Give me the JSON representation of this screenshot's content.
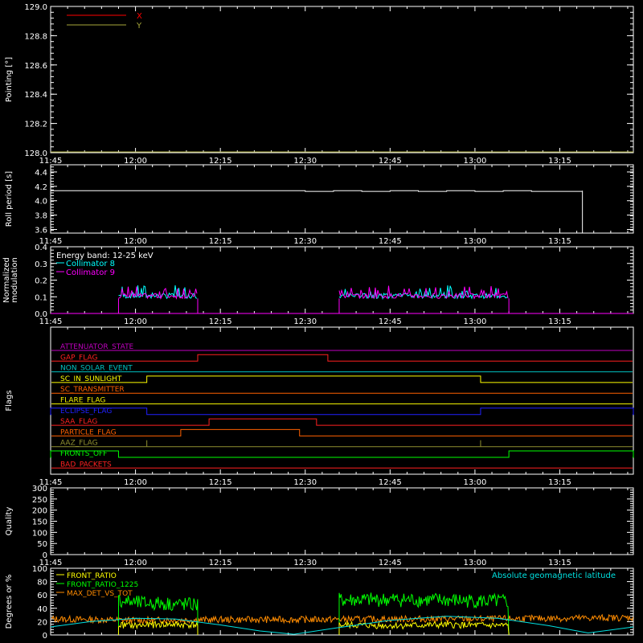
{
  "chart_data": [
    {
      "type": "line",
      "panel": "pointing",
      "ylabel": "Pointing [°]",
      "ylim": [
        128.0,
        129.0
      ],
      "yticks": [
        "128.0",
        "128.2",
        "128.4",
        "128.6",
        "128.8",
        "129.0"
      ],
      "xlim": [
        "11:45",
        "13:28"
      ],
      "xticks": [
        "11:45",
        "12:00",
        "12:15",
        "12:30",
        "12:45",
        "13:00",
        "13:15"
      ],
      "legend": "top-left",
      "series": [
        {
          "name": "X",
          "color": "#ff0000",
          "x": [
            "11:45",
            "13:28"
          ],
          "values": [
            128.0,
            128.0
          ]
        },
        {
          "name": "Y",
          "color": "#a8a83a",
          "x": [
            "11:45",
            "13:28"
          ],
          "values": [
            128.0,
            128.0
          ]
        }
      ]
    },
    {
      "type": "line",
      "panel": "roll",
      "ylabel": "Roll period [s]",
      "ylim": [
        3.55,
        4.5
      ],
      "yticks": [
        "3.6",
        "3.8",
        "4.0",
        "4.2",
        "4.4"
      ],
      "xticks": [
        "11:45",
        "12:00",
        "12:15",
        "12:30",
        "12:45",
        "13:00",
        "13:15"
      ],
      "series": [
        {
          "name": "",
          "color": "#ffffff",
          "x": [
            "11:45",
            "12:30",
            "12:30",
            "12:35",
            "12:40",
            "12:45",
            "12:50",
            "12:55",
            "13:00",
            "13:05",
            "13:10",
            "13:19",
            "13:19"
          ],
          "values": [
            4.14,
            4.14,
            4.13,
            4.14,
            4.13,
            4.14,
            4.13,
            4.14,
            4.13,
            4.14,
            4.13,
            4.14,
            3.55
          ]
        }
      ]
    },
    {
      "type": "line",
      "panel": "modulation",
      "ylabel": "Normalized modulation",
      "ylim": [
        0.0,
        0.4
      ],
      "yticks": [
        "0.0",
        "0.1",
        "0.2",
        "0.3",
        "0.4"
      ],
      "xticks": [
        "11:45",
        "12:00",
        "12:15",
        "12:30",
        "12:45",
        "13:00",
        "13:15"
      ],
      "annotation": "Energy band: 12-25 keV",
      "series": [
        {
          "name": "Collimator 8",
          "color": "#00ffff",
          "x": [
            "11:57",
            "12:00",
            "12:03",
            "12:06",
            "12:09",
            "12:11",
            "12:36",
            "12:40",
            "12:45",
            "12:50",
            "12:55",
            "13:00",
            "13:05"
          ],
          "values": [
            0.09,
            0.13,
            0.11,
            0.14,
            0.12,
            0.1,
            0.09,
            0.14,
            0.17,
            0.15,
            0.12,
            0.11,
            0.1
          ]
        },
        {
          "name": "Collimator 9",
          "color": "#ff00ff",
          "x": [
            "11:57",
            "12:00",
            "12:03",
            "12:06",
            "12:09",
            "12:11",
            "12:36",
            "12:40",
            "12:45",
            "12:50",
            "12:55",
            "13:00",
            "13:05"
          ],
          "values": [
            0.08,
            0.14,
            0.12,
            0.15,
            0.11,
            0.1,
            0.1,
            0.16,
            0.2,
            0.14,
            0.13,
            0.12,
            0.09
          ]
        }
      ],
      "active_intervals": [
        [
          "11:57",
          "12:11"
        ],
        [
          "12:36",
          "13:06"
        ]
      ]
    },
    {
      "type": "line",
      "panel": "flags",
      "ylabel": "Flags",
      "xticks": [
        "11:45",
        "12:00",
        "12:15",
        "12:30",
        "12:45",
        "13:00",
        "13:15"
      ],
      "flags": [
        {
          "label": "ATTENUATOR_STATE",
          "color": "#c000c0",
          "on": []
        },
        {
          "label": "GAP_FLAG",
          "color": "#ff2020",
          "on": [
            [
              "12:11",
              "12:34"
            ]
          ]
        },
        {
          "label": "NON_SOLAR_EVENT",
          "color": "#00c0c0",
          "on": []
        },
        {
          "label": "SC_IN_SUNLIGHT",
          "color": "#ffff00",
          "on": [
            [
              "12:02",
              "13:01"
            ]
          ]
        },
        {
          "label": "SC_TRANSMITTER",
          "color": "#ff6000",
          "on": []
        },
        {
          "label": "FLARE_FLAG",
          "color": "#f0f000",
          "on": []
        },
        {
          "label": "ECLIPSE_FLAG",
          "color": "#2020ff",
          "on": [
            [
              "11:45",
              "12:02"
            ],
            [
              "13:01",
              "13:28"
            ]
          ]
        },
        {
          "label": "SAA_FLAG",
          "color": "#ff2020",
          "on": [
            [
              "12:13",
              "12:32"
            ]
          ]
        },
        {
          "label": "PARTICLE_FLAG",
          "color": "#ff6000",
          "on": [
            [
              "12:08",
              "12:29"
            ]
          ]
        },
        {
          "label": "AAZ_FLAG",
          "color": "#909030",
          "on": [
            [
              "12:02",
              "12:02"
            ],
            [
              "13:01",
              "13:01"
            ]
          ]
        },
        {
          "label": "FRONTS_OFF",
          "color": "#00ff00",
          "on": [
            [
              "11:45",
              "11:57"
            ],
            [
              "13:06",
              "13:28"
            ]
          ]
        },
        {
          "label": "BAD_PACKETS",
          "color": "#ff2020",
          "on": []
        }
      ]
    },
    {
      "type": "line",
      "panel": "quality",
      "ylabel": "Quality",
      "ylim": [
        0,
        300
      ],
      "yticks": [
        "0",
        "50",
        "100",
        "150",
        "200",
        "250",
        "300"
      ],
      "xticks": [
        "11:45",
        "12:00",
        "12:15",
        "12:30",
        "12:45",
        "13:00",
        "13:15"
      ],
      "series": []
    },
    {
      "type": "line",
      "panel": "ratios",
      "ylabel": "Degrees or %",
      "ylim": [
        0,
        100
      ],
      "yticks": [
        "0",
        "20",
        "40",
        "60",
        "80",
        "100"
      ],
      "xticks": [
        "11:45",
        "12:00",
        "12:15",
        "12:30",
        "12:45",
        "13:00",
        "13:15"
      ],
      "series": [
        {
          "name": "FRONT_RATIO",
          "color": "#ffff00",
          "x": [
            "11:57",
            "12:00",
            "12:05",
            "12:11",
            "12:36",
            "12:45",
            "12:55",
            "13:06"
          ],
          "values": [
            15,
            14,
            16,
            15,
            15,
            14,
            15,
            14
          ]
        },
        {
          "name": "FRONT_RATIO_1225",
          "color": "#00ff00",
          "x": [
            "11:57",
            "12:00",
            "12:05",
            "12:11",
            "12:36",
            "12:45",
            "12:55",
            "13:06"
          ],
          "values": [
            52,
            48,
            47,
            45,
            52,
            53,
            52,
            50
          ]
        },
        {
          "name": "MAX_DET_VS_TOT",
          "color": "#ff8c00",
          "x": [
            "11:45",
            "12:00",
            "12:15",
            "12:30",
            "12:45",
            "13:00",
            "13:15",
            "13:28"
          ],
          "values": [
            24,
            22,
            23,
            23,
            24,
            24,
            25,
            26
          ]
        },
        {
          "name": "Absolute geomagnetic latitude",
          "color": "#00e0e0",
          "x": [
            "11:45",
            "11:52",
            "12:00",
            "12:07",
            "12:15",
            "12:22",
            "12:28",
            "12:35",
            "12:45",
            "12:55",
            "13:04",
            "13:13",
            "13:20",
            "13:28"
          ],
          "values": [
            12,
            20,
            25,
            24,
            15,
            6,
            1,
            10,
            22,
            28,
            25,
            14,
            3,
            12
          ]
        }
      ]
    }
  ]
}
